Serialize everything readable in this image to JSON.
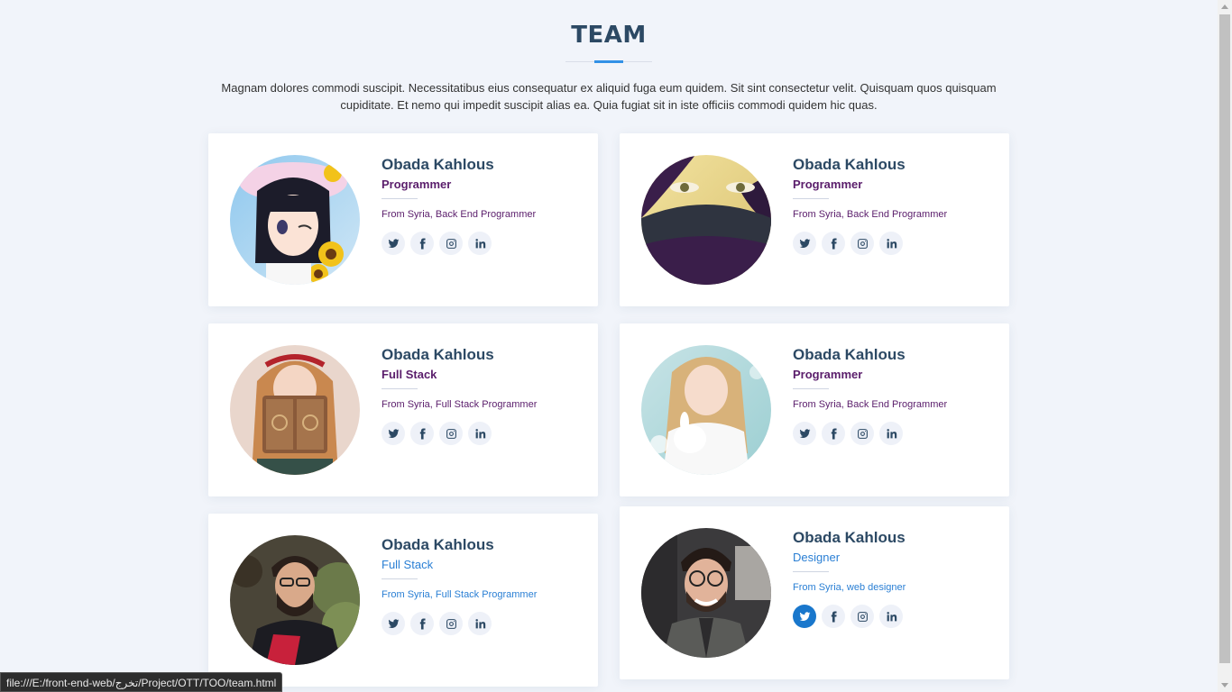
{
  "section": {
    "title": "TEAM",
    "description": "Magnam dolores commodi suscipit. Necessitatibus eius consequatur ex aliquid fuga eum quidem. Sit sint consectetur velit. Quisquam quos quisquam cupiditate. Et nemo qui impedit suscipit alias ea. Quia fugiat sit in iste officiis commodi quidem hic quas."
  },
  "members": [
    {
      "name": "Obada Kahlous",
      "role": "Programmer",
      "description": "From Syria, Back End Programmer"
    },
    {
      "name": "Obada Kahlous",
      "role": "Programmer",
      "description": "From Syria, Back End Programmer"
    },
    {
      "name": "Obada Kahlous",
      "role": "Full Stack",
      "description": "From Syria, Full Stack Programmer"
    },
    {
      "name": "Obada Kahlous",
      "role": "Programmer",
      "description": "From Syria, Back End Programmer"
    },
    {
      "name": "Obada Kahlous",
      "role": "Full Stack",
      "description": "From Syria, Full Stack Programmer"
    },
    {
      "name": "Obada Kahlous",
      "role": "Designer",
      "description": "From Syria, web designer"
    }
  ],
  "social_icons": [
    "twitter-icon",
    "facebook-icon",
    "instagram-icon",
    "linkedin-icon"
  ],
  "colors": {
    "heading": "#2c4964",
    "role_purple": "#5a1d6b",
    "role_blue": "#2a7fd4",
    "accent": "#1977cc",
    "background": "#f1f4fa"
  },
  "status_bar": {
    "url": "file:///E:/front-end-web/تخرج/Project/OTT/TOO/team.html"
  }
}
